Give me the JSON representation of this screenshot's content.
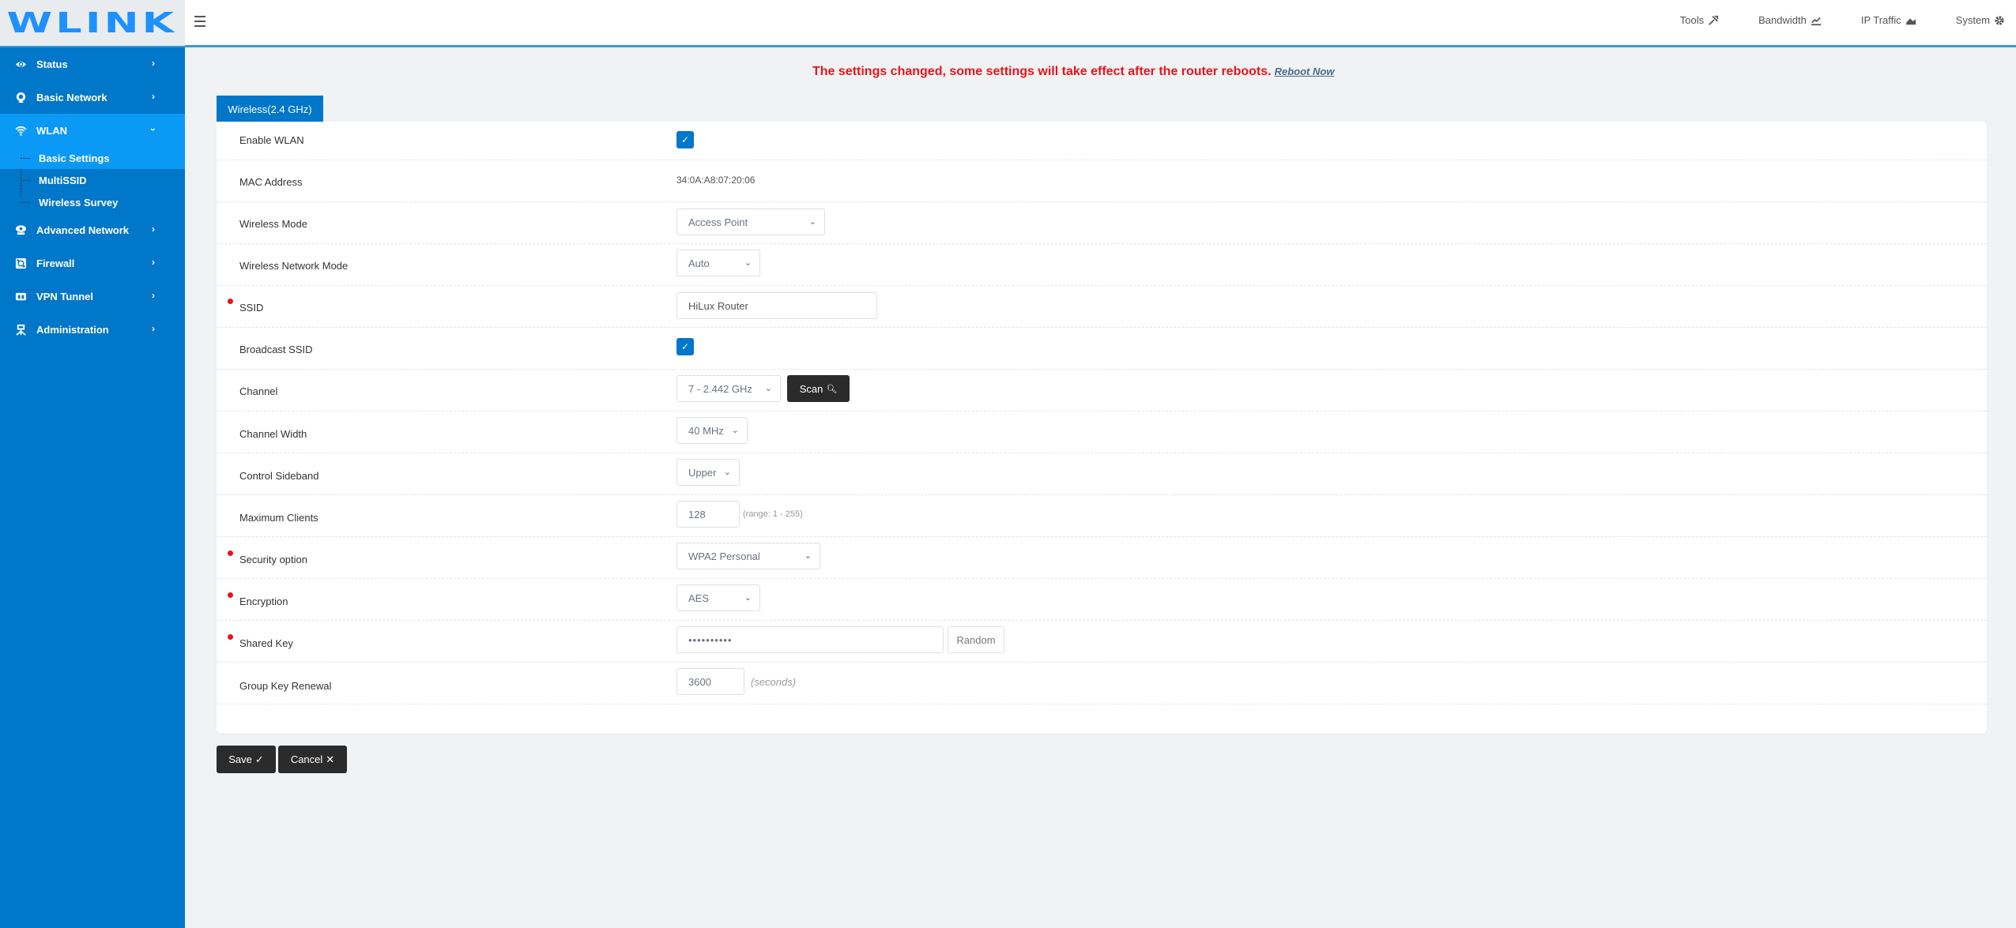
{
  "header": {
    "logo": "WLINK",
    "top_nav": [
      {
        "label": "Tools",
        "icon": "tools-icon"
      },
      {
        "label": "Bandwidth",
        "icon": "line-chart-icon"
      },
      {
        "label": "IP Traffic",
        "icon": "area-chart-icon"
      },
      {
        "label": "System",
        "icon": "gear-icon"
      }
    ]
  },
  "sidebar": {
    "items": [
      {
        "label": "Status",
        "icon": "eye-icon"
      },
      {
        "label": "Basic Network",
        "icon": "globe-icon"
      },
      {
        "label": "WLAN",
        "icon": "wifi-icon"
      },
      {
        "label": "Advanced Network",
        "icon": "cloud-network-icon"
      },
      {
        "label": "Firewall",
        "icon": "firewall-icon"
      },
      {
        "label": "VPN Tunnel",
        "icon": "vpn-icon"
      },
      {
        "label": "Administration",
        "icon": "admin-icon"
      }
    ],
    "wlan_sub": [
      {
        "label": "Basic Settings",
        "active": true
      },
      {
        "label": "MultiSSID"
      },
      {
        "label": "Wireless Survey"
      }
    ]
  },
  "notice": {
    "message": "The settings changed, some settings will take effect after the router reboots.",
    "link": "Reboot Now"
  },
  "tab": {
    "label": "Wireless(2.4 GHz)"
  },
  "form": {
    "enable_wlan": {
      "label": "Enable WLAN",
      "checked": true
    },
    "mac_address": {
      "label": "MAC Address",
      "value": "34:0A:A8:07:20:06"
    },
    "wireless_mode": {
      "label": "Wireless Mode",
      "value": "Access Point"
    },
    "network_mode": {
      "label": "Wireless Network Mode",
      "value": "Auto"
    },
    "ssid": {
      "label": "SSID",
      "value": "HiLux Router",
      "required": true
    },
    "broadcast_ssid": {
      "label": "Broadcast SSID",
      "checked": true
    },
    "channel": {
      "label": "Channel",
      "value": "7 - 2.442 GHz",
      "scan_label": "Scan"
    },
    "channel_width": {
      "label": "Channel Width",
      "value": "40 MHz"
    },
    "control_sideband": {
      "label": "Control Sideband",
      "value": "Upper"
    },
    "max_clients": {
      "label": "Maximum Clients",
      "value": "128",
      "hint": "(range: 1 - 255)"
    },
    "security": {
      "label": "Security option",
      "value": "WPA2 Personal",
      "required": true
    },
    "encryption": {
      "label": "Encryption",
      "value": "AES",
      "required": true
    },
    "shared_key": {
      "label": "Shared Key",
      "value": "••••••••••",
      "random_label": "Random",
      "required": true
    },
    "group_key_renewal": {
      "label": "Group Key Renewal",
      "value": "3600",
      "hint": "(seconds)"
    }
  },
  "actions": {
    "save": "Save",
    "cancel": "Cancel"
  }
}
